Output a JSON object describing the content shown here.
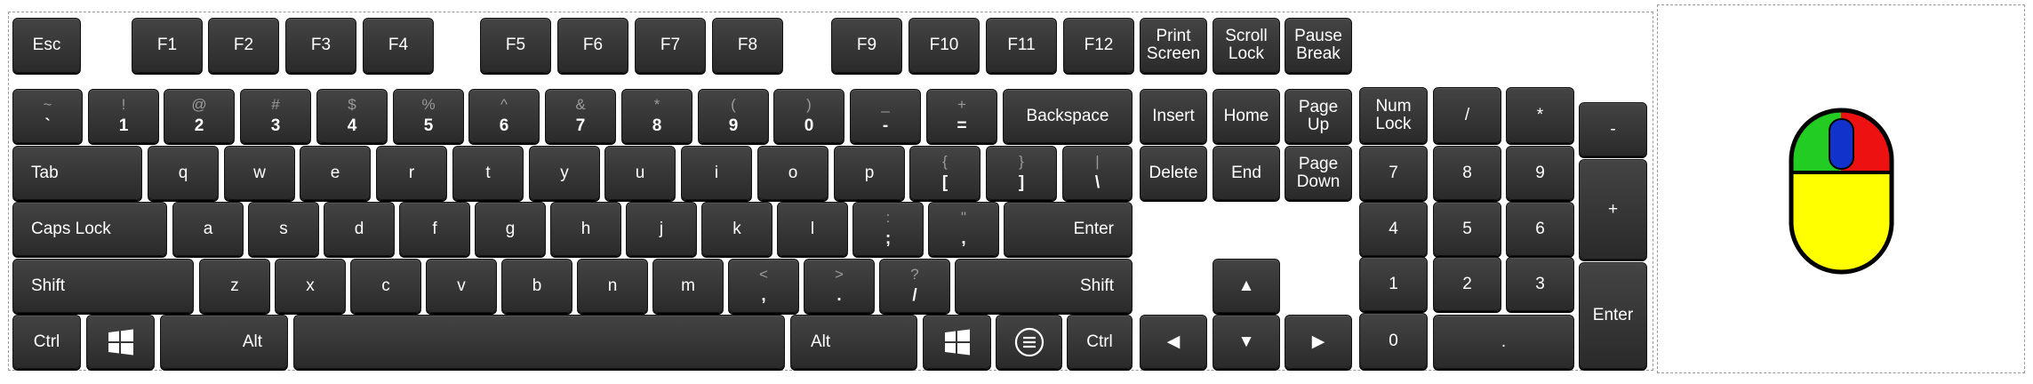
{
  "keyboard": {
    "function_row": {
      "esc": "Esc",
      "f1": "F1",
      "f2": "F2",
      "f3": "F3",
      "f4": "F4",
      "f5": "F5",
      "f6": "F6",
      "f7": "F7",
      "f8": "F8",
      "f9": "F9",
      "f10": "F10",
      "f11": "F11",
      "f12": "F12",
      "print_screen": [
        "Print",
        "Screen"
      ],
      "scroll_lock": [
        "Scroll",
        "Lock"
      ],
      "pause_break": [
        "Pause",
        "Break"
      ]
    },
    "number_row": [
      {
        "shift": "~",
        "main": "`"
      },
      {
        "shift": "!",
        "main": "1"
      },
      {
        "shift": "@",
        "main": "2"
      },
      {
        "shift": "#",
        "main": "3"
      },
      {
        "shift": "$",
        "main": "4"
      },
      {
        "shift": "%",
        "main": "5"
      },
      {
        "shift": "^",
        "main": "6"
      },
      {
        "shift": "&",
        "main": "7"
      },
      {
        "shift": "*",
        "main": "8"
      },
      {
        "shift": "(",
        "main": "9"
      },
      {
        "shift": ")",
        "main": "0"
      },
      {
        "shift": "_",
        "main": "-"
      },
      {
        "shift": "+",
        "main": "="
      }
    ],
    "backspace": "Backspace",
    "tab": "Tab",
    "top_row": [
      "q",
      "w",
      "e",
      "r",
      "t",
      "y",
      "u",
      "i",
      "o",
      "p"
    ],
    "top_row_symbols": [
      {
        "shift": "{",
        "main": "["
      },
      {
        "shift": "}",
        "main": "]"
      },
      {
        "shift": "|",
        "main": "\\"
      }
    ],
    "caps_lock": "Caps Lock",
    "home_row": [
      "a",
      "s",
      "d",
      "f",
      "g",
      "h",
      "j",
      "k",
      "l"
    ],
    "home_row_symbols": [
      {
        "shift": ":",
        "main": ";"
      },
      {
        "shift": "\"",
        "main": ","
      }
    ],
    "enter": "Enter",
    "shift_left": "Shift",
    "bottom_row": [
      "z",
      "x",
      "c",
      "v",
      "b",
      "n",
      "m"
    ],
    "bottom_row_symbols": [
      {
        "shift": "<",
        "main": ","
      },
      {
        "shift": ">",
        "main": "."
      },
      {
        "shift": "?",
        "main": "/"
      }
    ],
    "shift_right": "Shift",
    "ctrl_left": "Ctrl",
    "alt_left": "Alt",
    "alt_right": "Alt",
    "ctrl_right": "Ctrl",
    "nav": {
      "insert": "Insert",
      "home": "Home",
      "page_up": "Page Up",
      "delete": "Delete",
      "end": "End",
      "page_down": [
        "Page",
        "Down"
      ]
    },
    "arrows": {
      "up": "▲",
      "left": "◀",
      "down": "▼",
      "right": "▶"
    },
    "numpad": {
      "num_lock": [
        "Num",
        "Lock"
      ],
      "divide": "/",
      "multiply": "*",
      "minus": "-",
      "n7": "7",
      "n8": "8",
      "n9": "9",
      "plus": "+",
      "n4": "4",
      "n5": "5",
      "n6": "6",
      "n1": "1",
      "n2": "2",
      "n3": "3",
      "enter": "Enter",
      "n0": "0",
      "decimal": "."
    }
  },
  "mouse": {
    "left_button_color": "#22cc22",
    "right_button_color": "#ee1111",
    "wheel_color": "#1133cc",
    "body_color": "#ffff00",
    "outline_color": "#000000"
  },
  "colors": {
    "key_fill": "#333333",
    "key_text": "#ffffff",
    "shifted_text": "#9a9a9a"
  }
}
